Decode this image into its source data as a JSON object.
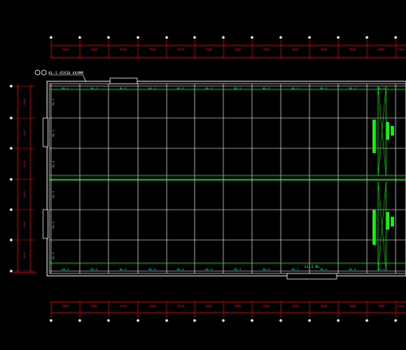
{
  "drawing": {
    "colors": {
      "background": "#000000",
      "dimension": "#ff0000",
      "grid": "#ffffff",
      "cyan_label": "#00ffff",
      "green_line": "#00ff00",
      "node": "#ffffff"
    },
    "top_dimension": {
      "segment_labels": [
        "3600",
        "3600",
        "3600",
        "3600",
        "3600",
        "3600",
        "3600",
        "3600",
        "3600",
        "3600",
        "3600",
        "3600",
        "3600"
      ]
    },
    "bottom_dimension": {
      "segment_labels": [
        "3600",
        "3600",
        "3600",
        "3600",
        "3600",
        "3600",
        "3600",
        "3600",
        "3600",
        "3600",
        "3600",
        "3600",
        "3600"
      ]
    },
    "left_dimension": {
      "segment_labels": [
        "3600",
        "3600",
        "3600",
        "3600",
        "3600",
        "3600"
      ]
    },
    "callout": {
      "label": "KL-1 45X18 4X4MM"
    },
    "top_beam_labels": [
      "KL-1",
      "KL-1",
      "KL-1",
      "KL-1",
      "KL-1",
      "KL-1",
      "KL-1",
      "KL-1",
      "KL-1",
      "KL-1",
      "KL-1",
      "KL-1"
    ],
    "bottom_beam_labels": [
      "KL-1",
      "KL-1",
      "KL-1",
      "KL-1",
      "KL-1",
      "KL-1",
      "KL-1",
      "KL-1",
      "KL-1",
      "KL-1",
      "KL-1",
      "KL-1"
    ],
    "left_beam_labels": [
      "KL-1",
      "KL-1",
      "KL-1",
      "KL-1",
      "KL-1",
      "KL-1"
    ],
    "bottom_note": "LL-1 KL"
  }
}
